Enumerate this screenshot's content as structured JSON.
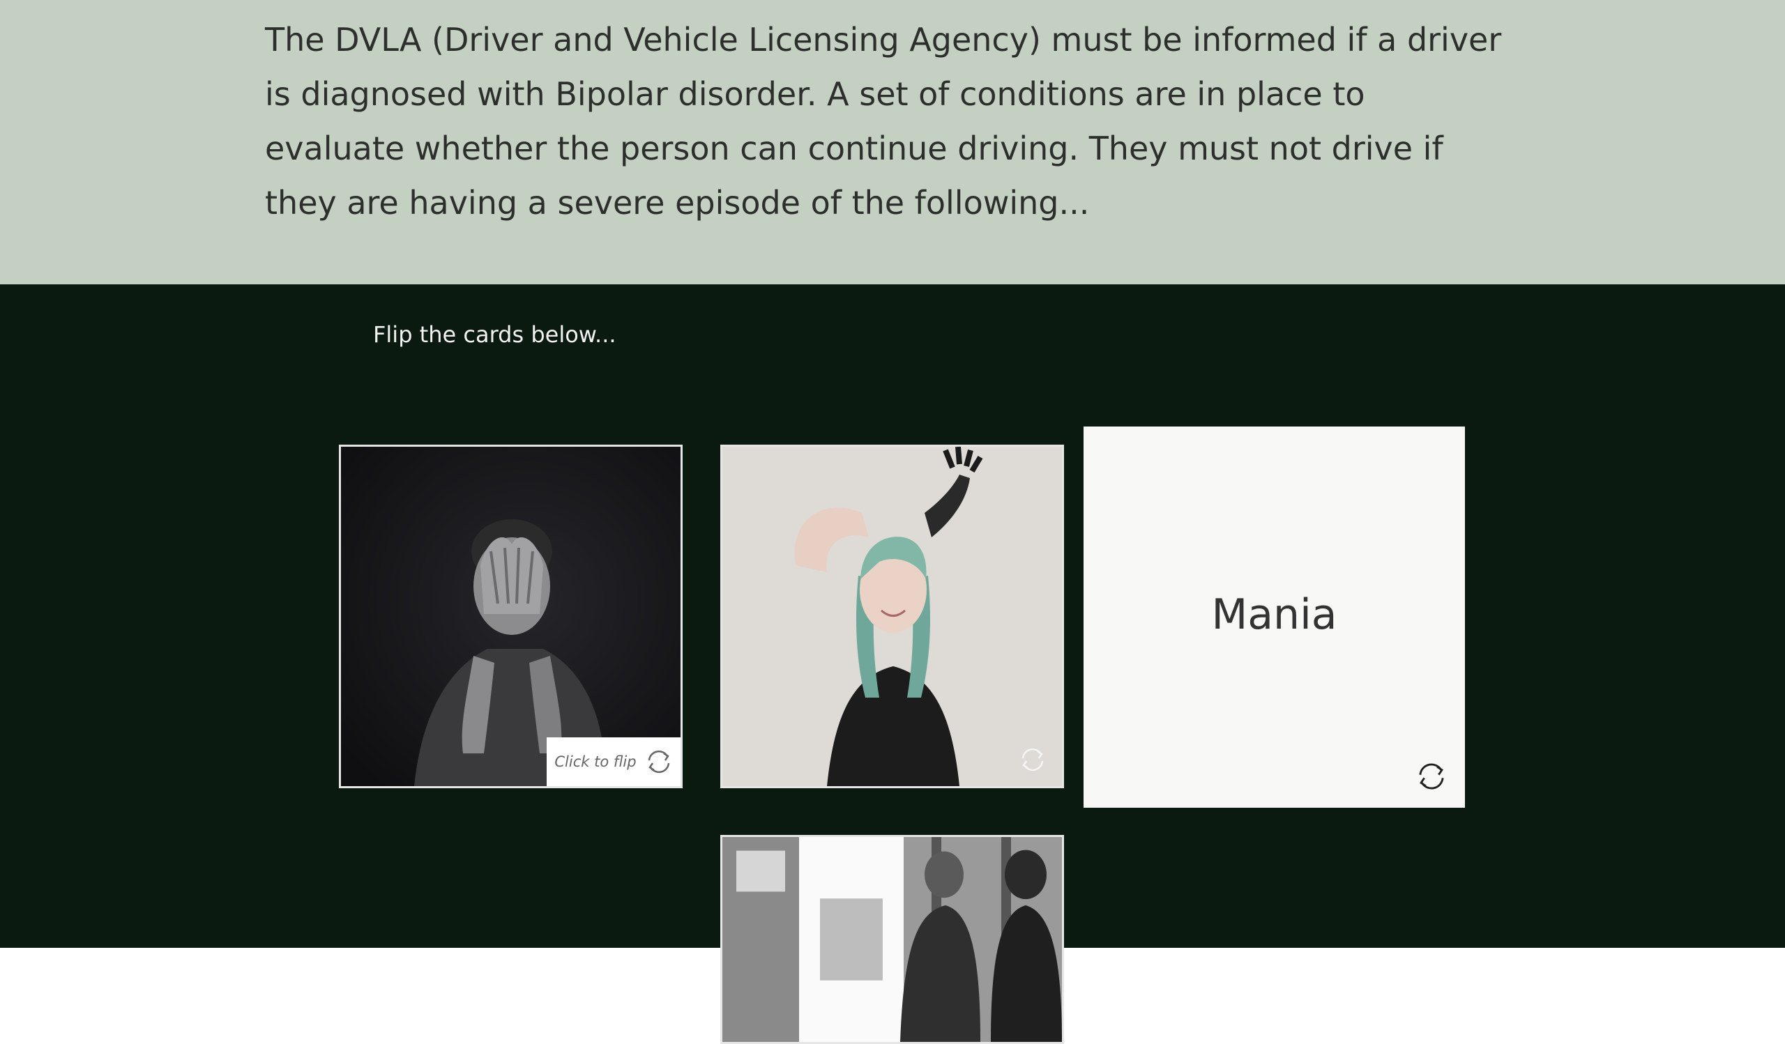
{
  "progress": {
    "fraction": 0.398
  },
  "intro": {
    "text": "The DVLA (Driver and Vehicle Licensing Agency) must be informed if a driver is diagnosed with Bipolar disorder. A set of conditions are in place to evaluate whether the person can continue driving. They must not drive if they are having a severe episode of the following..."
  },
  "cards_section": {
    "instruction": "Flip the cards below..."
  },
  "cards": [
    {
      "flip_label": "Click to flip",
      "icon": "flip-icon"
    },
    {
      "icon": "flip-icon"
    },
    {
      "title": "Mania",
      "icon": "flip-icon"
    },
    {}
  ],
  "colors": {
    "intro_bg": "#c3d0c2",
    "cards_bg": "#0b1a10",
    "progress": "#2f5d8f"
  }
}
